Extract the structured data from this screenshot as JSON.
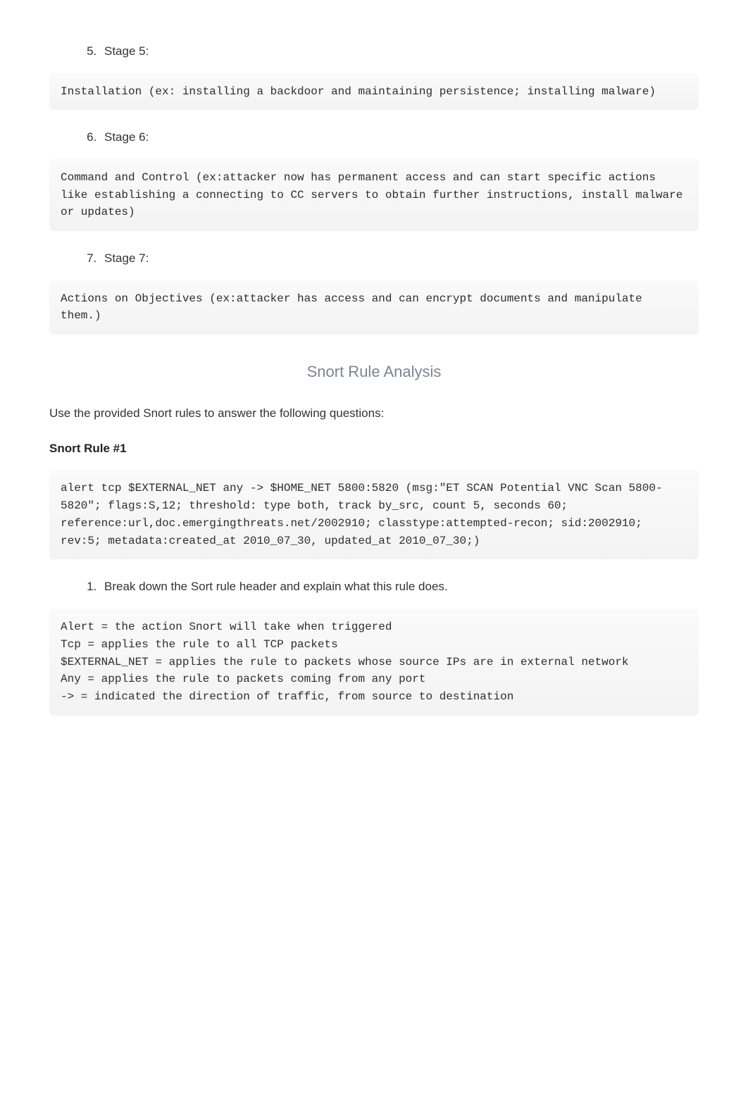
{
  "stages": [
    {
      "num": 5,
      "label": "Stage 5:",
      "code": "Installation (ex: installing a backdoor and maintaining persistence; installing malware)"
    },
    {
      "num": 6,
      "label": "Stage 6:",
      "code": "Command and Control (ex:attacker now has permanent access and can start specific actions like establishing a connecting to CC servers to obtain further instructions, install malware or updates)"
    },
    {
      "num": 7,
      "label": "Stage 7:",
      "code": "Actions on Objectives (ex:attacker has access and can encrypt documents and manipulate them.)"
    }
  ],
  "section_title": "Snort Rule Analysis",
  "intro": "Use the provided Snort rules to answer the following questions:",
  "rule_heading": "Snort Rule #1",
  "rule_code": "alert tcp $EXTERNAL_NET any -> $HOME_NET 5800:5820 (msg:\"ET SCAN Potential VNC Scan 5800-5820\"; flags:S,12; threshold: type both, track by_src, count 5, seconds 60; reference:url,doc.emergingthreats.net/2002910; classtype:attempted-recon; sid:2002910; rev:5; metadata:created_at 2010_07_30, updated_at 2010_07_30;)",
  "q1": {
    "num": 1,
    "label": "Break down the Sort rule header and explain what this rule does.",
    "answer": "Alert = the action Snort will take when triggered\nTcp = applies the rule to all TCP packets\n$EXTERNAL_NET = applies the rule to packets whose source IPs are in external network\nAny = applies the rule to packets coming from any port\n-> = indicated the direction of traffic, from source to destination"
  }
}
